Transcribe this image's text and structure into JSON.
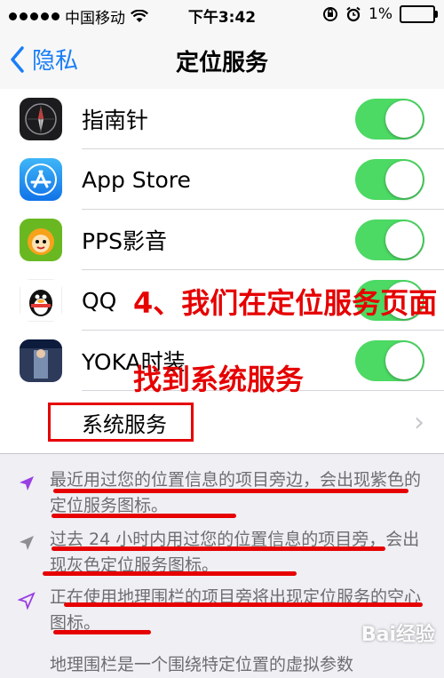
{
  "status_bar": {
    "carrier": "中国移动",
    "time": "下午3:42",
    "battery": "1%"
  },
  "nav": {
    "back_label": "隐私",
    "title": "定位服务"
  },
  "apps": [
    {
      "name": "指南针",
      "icon": "compass-icon",
      "enabled": true
    },
    {
      "name": "App Store",
      "icon": "app-store-icon",
      "enabled": true
    },
    {
      "name": "PPS影音",
      "icon": "pps-icon",
      "enabled": true
    },
    {
      "name": "QQ",
      "icon": "qq-penguin-icon",
      "enabled": true
    },
    {
      "name": "YOKA时装",
      "icon": "yoka-icon",
      "enabled": true
    }
  ],
  "system_services": {
    "label": "系统服务"
  },
  "notes": [
    {
      "text": "最近用过您的位置信息的项目旁边，会出现紫色的定位服务图标。",
      "icon_color": "#9a3fe3"
    },
    {
      "text": "过去 24 小时内用过您的位置信息的项目旁，会出现灰色定位服务图标。",
      "icon_color": "#8e8e93"
    },
    {
      "text": "正在使用地理围栏的项目旁将出现定位服务的空心图标。",
      "icon_color": "#9a3fe3"
    },
    {
      "text": "地理围栏是一个围绕特定位置的虚拟参数"
    }
  ],
  "overlay": {
    "step_text": "4、我们在定位服务页面",
    "step_text2": "找到系统服务"
  },
  "watermark": "Bai经验",
  "colors": {
    "accent": "#1a7ef6",
    "toggle_on": "#4cd964",
    "annotation": "#e60000"
  }
}
